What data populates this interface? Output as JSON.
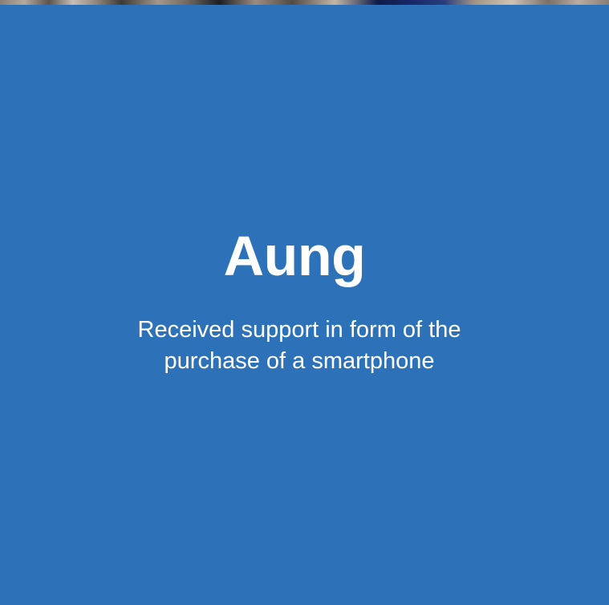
{
  "card": {
    "name": "Aung",
    "description": "Received support in form of the purchase of a smartphone"
  },
  "colors": {
    "card_background": "#2d72b8",
    "text": "#ffffff"
  }
}
